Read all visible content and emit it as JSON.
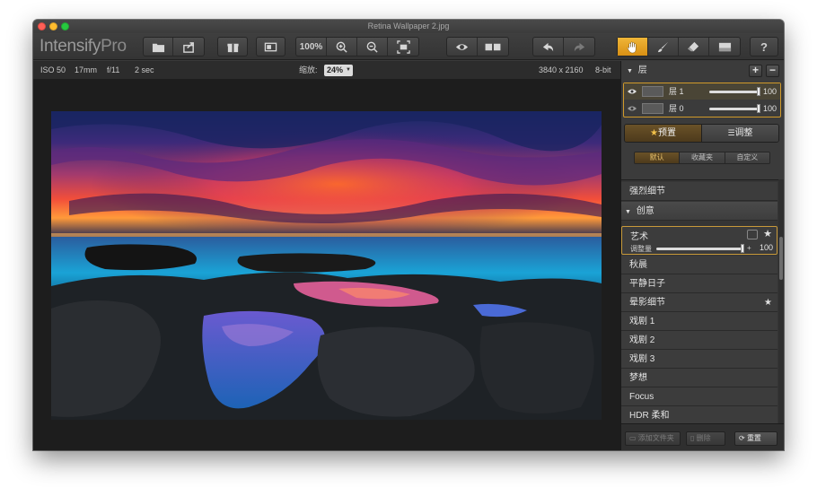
{
  "window": {
    "title": "Retina Wallpaper 2.jpg"
  },
  "app": {
    "name": "Intensify",
    "name_suffix": "Pro"
  },
  "toolbar": {
    "zoom_label": "100%",
    "icons": [
      "open-file-icon",
      "share-icon",
      "gift-icon",
      "single-view-icon",
      "zoom-in-icon",
      "zoom-out-icon",
      "fit-screen-icon",
      "eye-icon",
      "split-view-icon",
      "undo-icon",
      "redo-icon",
      "hand-tool-icon",
      "brush-tool-icon",
      "eraser-tool-icon",
      "mask-icon",
      "help-icon"
    ],
    "help_label": "?"
  },
  "info": {
    "iso": "ISO 50",
    "focal": "17mm",
    "aperture": "f/11",
    "shutter": "2 sec",
    "zoom_label": "缩放:",
    "zoom_value": "24%",
    "dimensions": "3840 x 2160",
    "bit_depth": "8-bit"
  },
  "layers": {
    "header": "层",
    "add": "+",
    "remove": "−",
    "items": [
      {
        "name": "层 1",
        "opacity": "100",
        "opacity_fraction": 1.0
      },
      {
        "name": "层 0",
        "opacity": "100",
        "opacity_fraction": 1.0
      }
    ]
  },
  "tabs": {
    "presets": "预置",
    "adjust": "调整"
  },
  "subtabs": [
    "默认",
    "收藏夹",
    "自定义"
  ],
  "presets": {
    "top_item": "强烈细节",
    "section": "创意",
    "active": {
      "name": "艺术",
      "amount_label": "调整量",
      "amount_value": "100",
      "plus": "+"
    },
    "items": [
      {
        "name": "秋晨",
        "starred": false
      },
      {
        "name": "平静日子",
        "starred": false
      },
      {
        "name": "晕影细节",
        "starred": true
      },
      {
        "name": "戏剧 1",
        "starred": false
      },
      {
        "name": "戏剧 2",
        "starred": false
      },
      {
        "name": "戏剧 3",
        "starred": false
      },
      {
        "name": "梦想",
        "starred": false
      },
      {
        "name": "Focus",
        "starred": false
      },
      {
        "name": "HDR 柔和",
        "starred": false
      }
    ]
  },
  "bottom": {
    "add_folder": "添加文件夹",
    "delete": "删除",
    "reset": "重置"
  },
  "colors": {
    "accent": "#e8a423",
    "panel": "#3b3b3b",
    "canvas": "#1d1d1d"
  }
}
